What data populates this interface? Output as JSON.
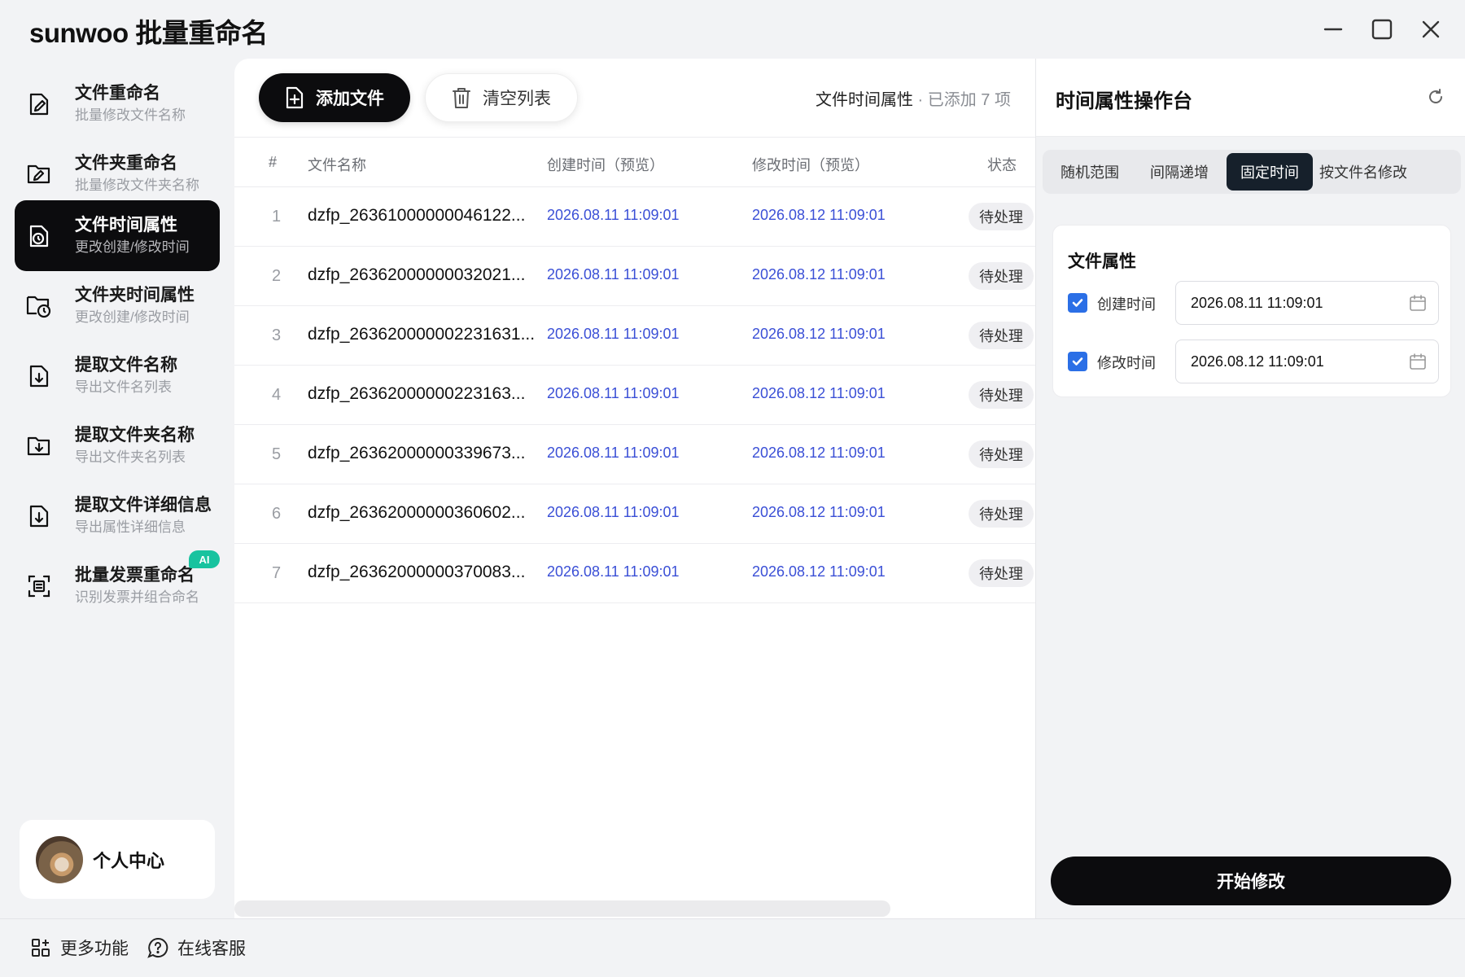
{
  "app": {
    "title": "sunwoo 批量重命名",
    "window_controls": [
      "minimize-icon",
      "maximize-icon",
      "close-icon"
    ]
  },
  "sidebar": {
    "items": [
      {
        "title": "文件重命名",
        "subtitle": "批量修改文件名称",
        "icon": "file-edit-icon",
        "active": false
      },
      {
        "title": "文件夹重命名",
        "subtitle": "批量修改文件夹名称",
        "icon": "folder-edit-icon",
        "active": false
      },
      {
        "title": "文件时间属性",
        "subtitle": "更改创建/修改时间",
        "icon": "file-clock-icon",
        "active": true
      },
      {
        "title": "文件夹时间属性",
        "subtitle": "更改创建/修改时间",
        "icon": "folder-clock-icon",
        "active": false
      },
      {
        "title": "提取文件名称",
        "subtitle": "导出文件名列表",
        "icon": "file-download-icon",
        "active": false
      },
      {
        "title": "提取文件夹名称",
        "subtitle": "导出文件夹名列表",
        "icon": "folder-download-icon",
        "active": false
      },
      {
        "title": "提取文件详细信息",
        "subtitle": "导出属性详细信息",
        "icon": "file-info-download-icon",
        "active": false
      },
      {
        "title": "批量发票重命名",
        "subtitle": "识别发票并组合命名",
        "icon": "scan-invoice-icon",
        "active": false,
        "badge": "AI"
      }
    ],
    "profile": {
      "label": "个人中心"
    }
  },
  "main": {
    "add_button": "添加文件",
    "clear_button": "清空列表",
    "status_label": "文件时间属性",
    "status_sep": " · ",
    "status_count": "已添加 7 项",
    "columns": [
      "#",
      "文件名称",
      "创建时间（预览）",
      "修改时间（预览）",
      "状态"
    ],
    "rows": [
      {
        "idx": "1",
        "name": "dzfp_26361000000046122...",
        "ctime": "2026.08.11 11:09:01",
        "mtime": "2026.08.12 11:09:01",
        "status": "待处理"
      },
      {
        "idx": "2",
        "name": "dzfp_26362000000032021...",
        "ctime": "2026.08.11 11:09:01",
        "mtime": "2026.08.12 11:09:01",
        "status": "待处理"
      },
      {
        "idx": "3",
        "name": "dzfp_263620000002231631...",
        "ctime": "2026.08.11 11:09:01",
        "mtime": "2026.08.12 11:09:01",
        "status": "待处理"
      },
      {
        "idx": "4",
        "name": "dzfp_26362000000223163...",
        "ctime": "2026.08.11 11:09:01",
        "mtime": "2026.08.12 11:09:01",
        "status": "待处理"
      },
      {
        "idx": "5",
        "name": "dzfp_26362000000339673...",
        "ctime": "2026.08.11 11:09:01",
        "mtime": "2026.08.12 11:09:01",
        "status": "待处理"
      },
      {
        "idx": "6",
        "name": "dzfp_26362000000360602...",
        "ctime": "2026.08.11 11:09:01",
        "mtime": "2026.08.12 11:09:01",
        "status": "待处理"
      },
      {
        "idx": "7",
        "name": "dzfp_26362000000370083...",
        "ctime": "2026.08.11 11:09:01",
        "mtime": "2026.08.12 11:09:01",
        "status": "待处理"
      }
    ]
  },
  "right_panel": {
    "title": "时间属性操作台",
    "tabs": [
      {
        "label": "随机范围",
        "active": false
      },
      {
        "label": "间隔递增",
        "active": false
      },
      {
        "label": "固定时间",
        "active": true
      },
      {
        "label": "按文件名修改",
        "active": false
      }
    ],
    "card_title": "文件属性",
    "create_label": "创建时间",
    "create_checked": true,
    "create_value": "2026.08.11 11:09:01",
    "modify_label": "修改时间",
    "modify_checked": true,
    "modify_value": "2026.08.12 11:09:01",
    "start_button": "开始修改"
  },
  "bottom": {
    "more_label": "更多功能",
    "service_label": "在线客服"
  },
  "colors": {
    "accent_dark": "#0c0c0e",
    "date_blue": "#3a4fd6",
    "checkbox_blue": "#2b6fe6",
    "ai_badge": "#18c39f"
  }
}
